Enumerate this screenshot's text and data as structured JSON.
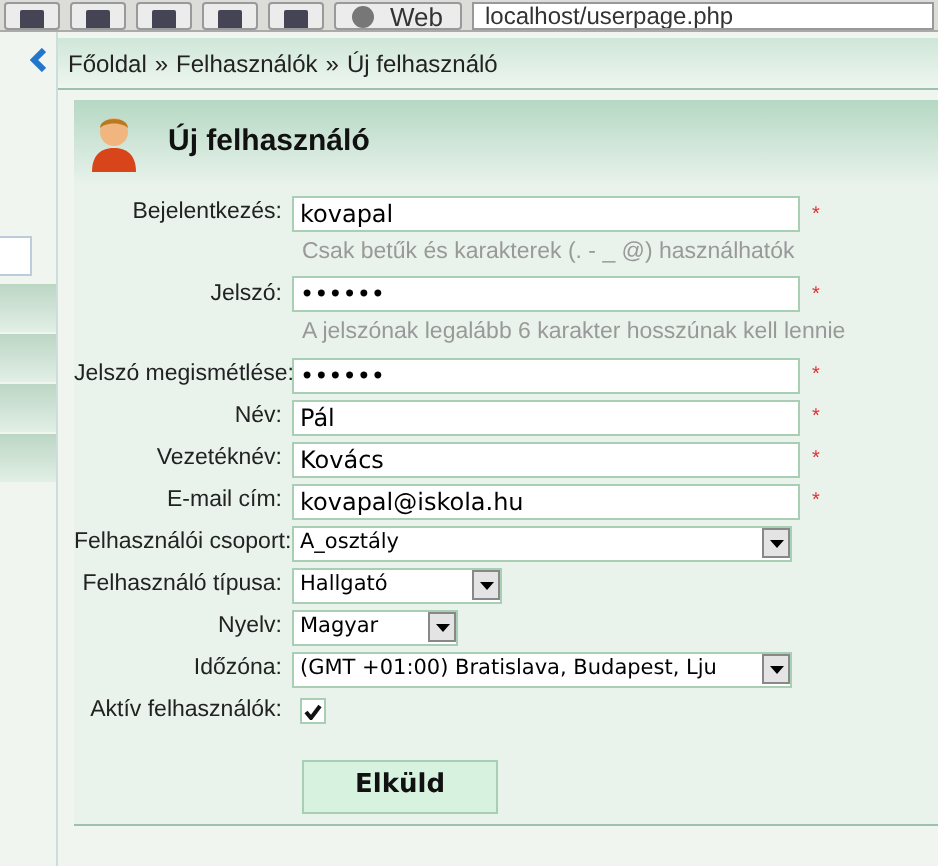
{
  "browser": {
    "web_button": "Web",
    "address": "localhost/userpage.php"
  },
  "breadcrumb": [
    "Főoldal",
    "Felhasználók",
    "Új felhasználó"
  ],
  "breadcrumb_separator": "»",
  "panel": {
    "title": "Új felhasználó"
  },
  "fields": [
    {
      "kind": "text",
      "label": "Bejelentkezés:",
      "value": "kovapal",
      "mark": "*",
      "hint": "Csak betűk és karakterek (. - _ @) használhatók"
    },
    {
      "kind": "text",
      "label": "Jelszó:",
      "value": "••••••",
      "mark": "*",
      "hint": "A jelszónak legalább 6 karakter hosszúnak kell lennie"
    },
    {
      "kind": "text",
      "label": "Jelszó megismétlése:",
      "value": "••••••",
      "mark": "*"
    },
    {
      "kind": "text",
      "label": "Név:",
      "value": "Pál",
      "mark": "*"
    },
    {
      "kind": "text",
      "label": "Vezetéknév:",
      "value": "Kovács",
      "mark": "*"
    },
    {
      "kind": "text",
      "label": "E-mail cím:",
      "value": "kovapal@iskola.hu",
      "mark": "*"
    },
    {
      "kind": "select",
      "label": "Felhasználói csoport:",
      "value": "A_osztály"
    },
    {
      "kind": "select",
      "label": "Felhasználó típusa:",
      "value": "Hallgató"
    },
    {
      "kind": "select",
      "label": "Nyelv:",
      "value": "Magyar"
    },
    {
      "kind": "select",
      "label": "Időzóna:",
      "value": "(GMT +01:00) Bratislava, Budapest, Lju"
    },
    {
      "kind": "checkbox",
      "label": "Aktív felhasználók:",
      "checked": true
    }
  ],
  "submit": "Elküld"
}
